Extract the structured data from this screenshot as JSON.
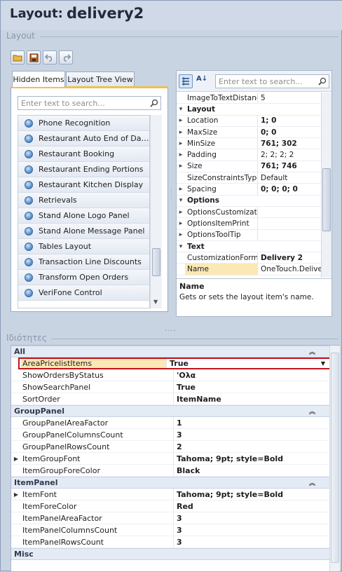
{
  "title": {
    "label": "Layout:",
    "value": "delivery2"
  },
  "layout_group": {
    "caption": "Layout"
  },
  "toolbar": {
    "buttons": [
      {
        "icon": "open-folder-icon"
      },
      {
        "icon": "save-icon"
      },
      {
        "icon": "undo-icon"
      },
      {
        "icon": "redo-icon"
      }
    ]
  },
  "tabs": [
    {
      "label": "Hidden Items",
      "active": true
    },
    {
      "label": "Layout Tree View",
      "active": false
    }
  ],
  "hidden_items": {
    "search_placeholder": "Enter text to search...",
    "items": [
      "Phone Recognition",
      "Restaurant Auto End of Day-S...",
      "Restaurant Booking",
      "Restaurant Ending Portions",
      "Restaurant Kitchen Display",
      "Retrievals",
      "Stand Alone Logo Panel",
      "Stand Alone Message Panel",
      "Tables Layout",
      "Transaction Line Discounts",
      "Transform Open Orders",
      "VeriFone Control"
    ]
  },
  "property_grid": {
    "search_placeholder": "Enter text to search...",
    "rows": [
      {
        "kind": "prop",
        "name": "ImageToTextDistance",
        "value": "5",
        "expand": ""
      },
      {
        "kind": "cat",
        "name": "Layout"
      },
      {
        "kind": "prop",
        "name": "Location",
        "value": "1; 0",
        "bold": true,
        "expand": "▸"
      },
      {
        "kind": "prop",
        "name": "MaxSize",
        "value": "0; 0",
        "bold": true,
        "expand": "▸"
      },
      {
        "kind": "prop",
        "name": "MinSize",
        "value": "761; 302",
        "bold": true,
        "expand": "▸"
      },
      {
        "kind": "prop",
        "name": "Padding",
        "value": "2; 2; 2; 2",
        "expand": "▸"
      },
      {
        "kind": "prop",
        "name": "Size",
        "value": "761; 746",
        "bold": true,
        "expand": "▸"
      },
      {
        "kind": "prop",
        "name": "SizeConstraintsType",
        "value": "Default",
        "expand": ""
      },
      {
        "kind": "prop",
        "name": "Spacing",
        "value": "0; 0; 0; 0",
        "bold": true,
        "expand": "▸"
      },
      {
        "kind": "cat",
        "name": "Options"
      },
      {
        "kind": "prop",
        "name": "OptionsCustomization",
        "value": "",
        "expand": "▸"
      },
      {
        "kind": "prop",
        "name": "OptionsItemPrint",
        "value": "",
        "expand": "▸"
      },
      {
        "kind": "prop",
        "name": "OptionsToolTip",
        "value": "",
        "expand": "▸"
      },
      {
        "kind": "cat",
        "name": "Text"
      },
      {
        "kind": "prop",
        "name": "CustomizationFormTe",
        "value": "Delivery 2",
        "bold": true,
        "expand": ""
      },
      {
        "kind": "prop",
        "name": "Name",
        "value": "OneTouch.Delivery",
        "selected": true,
        "expand": ""
      }
    ],
    "description": {
      "title": "Name",
      "text": "Gets or sets the layout item's name."
    }
  },
  "properties_group": {
    "caption": "Ιδιότητες",
    "categories": [
      {
        "name": "All",
        "rows": [
          {
            "name": "AreaPricelistItems",
            "value": "True",
            "dropdown": true,
            "highlight": true
          },
          {
            "name": "ShowOrdersByStatus",
            "value": "'Ολα"
          },
          {
            "name": "ShowSearchPanel",
            "value": "True"
          },
          {
            "name": "SortOrder",
            "value": "ItemName"
          }
        ]
      },
      {
        "name": "GroupPanel",
        "rows": [
          {
            "name": "GroupPanelAreaFactor",
            "value": "1"
          },
          {
            "name": "GroupPanelColumnsCount",
            "value": "3"
          },
          {
            "name": "GroupPanelRowsCount",
            "value": "2"
          },
          {
            "name": "ItemGroupFont",
            "value": "Tahoma; 9pt; style=Bold",
            "expand": true
          },
          {
            "name": "ItemGroupForeColor",
            "value": "Black"
          }
        ]
      },
      {
        "name": "ItemPanel",
        "rows": [
          {
            "name": "ItemFont",
            "value": "Tahoma; 9pt; style=Bold",
            "expand": true
          },
          {
            "name": "ItemForeColor",
            "value": "Red"
          },
          {
            "name": "ItemPanelAreaFactor",
            "value": "3"
          },
          {
            "name": "ItemPanelColumnsCount",
            "value": "3"
          },
          {
            "name": "ItemPanelRowsCount",
            "value": "3"
          }
        ]
      },
      {
        "name": "Misc",
        "rows": []
      }
    ]
  },
  "colors": {
    "highlight_border": "#c0141c",
    "selected_row": "#fbe9b5",
    "category_bg": "#e4ebf5"
  }
}
